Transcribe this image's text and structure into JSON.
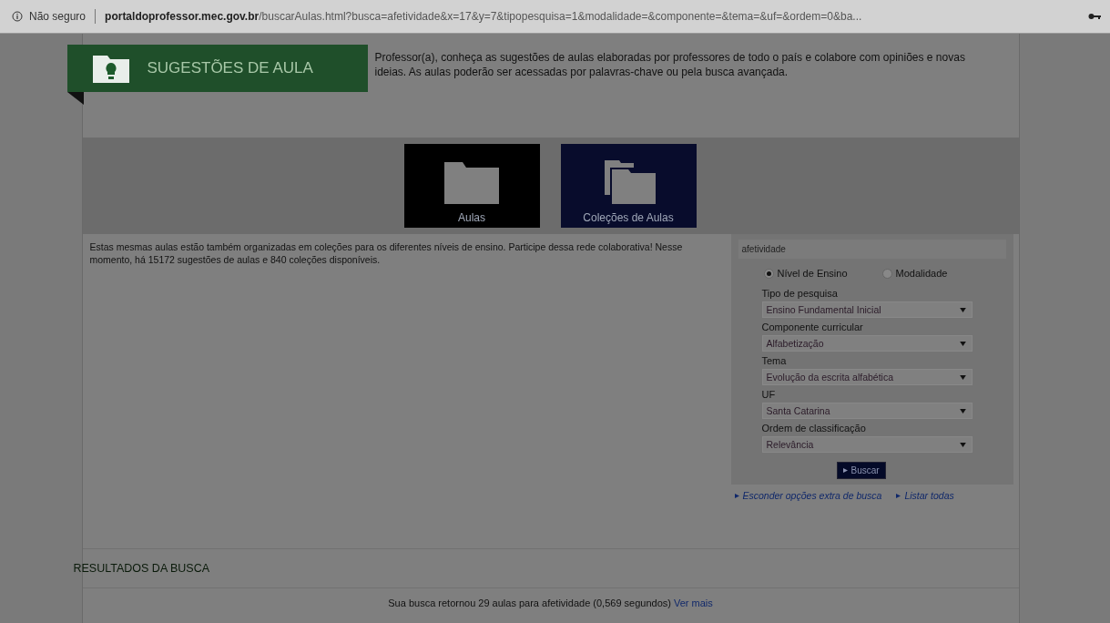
{
  "address_bar": {
    "security": "Não seguro",
    "domain": "portaldoprofessor.mec.gov.br",
    "path": "/buscarAulas.html?busca=afetividade&x=17&y=7&tipopesquisa=1&modalidade=&componente=&tema=&uf=&ordem=0&ba..."
  },
  "header": {
    "title": "SUGESTÕES DE AULA",
    "intro": "Professor(a), conheça as sugestões de aulas elaboradas por professores de todo o país e colabore com opiniões e novas ideias. As aulas poderão ser acessadas por palavras-chave ou pela busca avançada."
  },
  "tiles": [
    {
      "label": "Aulas",
      "kind": "single",
      "selected": false
    },
    {
      "label": "Coleções de Aulas",
      "kind": "stack",
      "selected": true
    }
  ],
  "description": "Estas mesmas aulas estão também organizadas em coleções para os diferentes níveis de ensino. Participe dessa rede colaborativa! Nesse momento, há 15172 sugestões de aulas e 840 coleções disponíveis.",
  "search": {
    "query": "afetividade",
    "radios": [
      {
        "label": "Nível de Ensino",
        "selected": true
      },
      {
        "label": "Modalidade",
        "selected": false
      }
    ],
    "selects": [
      {
        "label": "Tipo de pesquisa",
        "value": "Ensino Fundamental Inicial"
      },
      {
        "label": "Componente curricular",
        "value": "Alfabetização"
      },
      {
        "label": "Tema",
        "value": "Evolução da escrita alfabética"
      },
      {
        "label": "UF",
        "value": "Santa Catarina"
      },
      {
        "label": "Ordem de classificação",
        "value": "Relevância"
      }
    ],
    "button": "Buscar",
    "links": [
      "Esconder opções extra de busca",
      "Listar todas"
    ]
  },
  "results": {
    "heading": "RESULTADOS DA BUSCA",
    "summary": "Sua busca retornou 29 aulas para afetividade (0,569 segundos)",
    "more": "Ver mais"
  }
}
